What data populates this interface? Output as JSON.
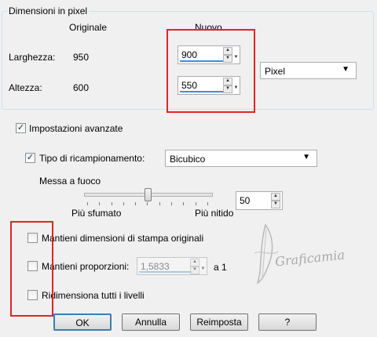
{
  "pixel_dims": {
    "legend": "Dimensioni in pixel",
    "col_original": "Originale",
    "col_new": "Nuovo",
    "width_label": "Larghezza:",
    "width_original": "950",
    "width_new": "900",
    "height_label": "Altezza:",
    "height_original": "600",
    "height_new": "550",
    "unit": "Pixel"
  },
  "advanced": {
    "label": "Impostazioni avanzate",
    "checked": true
  },
  "resample": {
    "label": "Tipo di ricampionamento:",
    "checked": true,
    "value": "Bicubico"
  },
  "sharpen": {
    "label": "Messa a fuoco",
    "value": "50",
    "left_label": "Più sfumato",
    "right_label": "Più nitido",
    "level": 0.5
  },
  "options": {
    "keep_print_size": "Mantieni dimensioni di stampa originali",
    "keep_ratio": "Mantieni proporzioni:",
    "ratio_value": "1,5833",
    "ratio_suffix": "a 1",
    "resize_all_layers": "Ridimensiona tutti i livelli"
  },
  "buttons": {
    "ok": "OK",
    "cancel": "Annulla",
    "reset": "Reimposta",
    "help": "?"
  },
  "watermark": "Graficamia",
  "colors": {
    "highlight": "#e02424",
    "spin_bar": "#3c8fe0"
  }
}
